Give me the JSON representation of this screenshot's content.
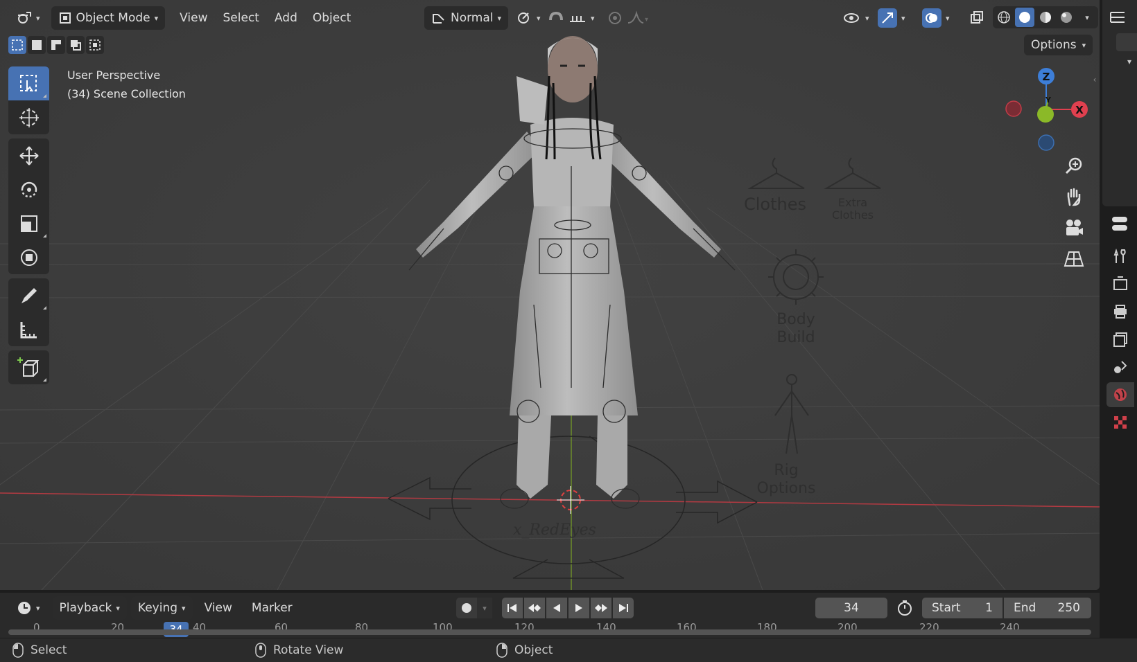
{
  "header": {
    "mode_label": "Object Mode",
    "menus": [
      "View",
      "Select",
      "Add",
      "Object"
    ],
    "transform_orientation": "Normal",
    "options_label": "Options"
  },
  "viewport": {
    "perspective_label": "User Perspective",
    "collection_label": "(34) Scene Collection",
    "gizmo": {
      "z": "Z",
      "y": "Y",
      "x": "X"
    }
  },
  "rig_ui": {
    "clothes_label": "Clothes",
    "extra_clothes_label_1": "Extra",
    "extra_clothes_label_2": "Clothes",
    "body_build_label_1": "Body",
    "body_build_label_2": "Build",
    "rig_options_label_1": "Rig",
    "rig_options_label_2": "Options",
    "signature": "x_RedEyes"
  },
  "timeline": {
    "menus": [
      "Playback",
      "Keying",
      "View",
      "Marker"
    ],
    "current_frame": "34",
    "start_label": "Start",
    "start_value": "1",
    "end_label": "End",
    "end_value": "250",
    "ruler_ticks": [
      "0",
      "20",
      "34",
      "40",
      "60",
      "80",
      "100",
      "120",
      "140",
      "160",
      "180",
      "200",
      "220",
      "240"
    ]
  },
  "statusbar": {
    "left": "Select",
    "middle": "Rotate View",
    "right": "Object"
  },
  "colors": {
    "accent": "#4772b3",
    "axis_x": "#e0404f",
    "axis_y": "#8bb928",
    "axis_z": "#3d7ed8"
  }
}
